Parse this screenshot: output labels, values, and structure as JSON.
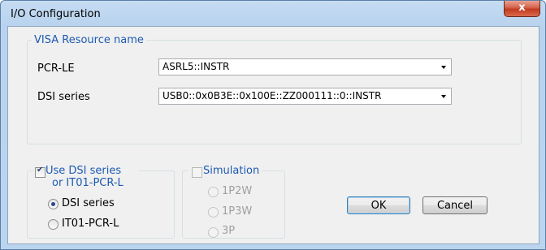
{
  "window": {
    "title": "I/O Configuration",
    "close_glyph": "x"
  },
  "visa_group": {
    "legend": "VISA Resource name",
    "pcr_label": "PCR-LE",
    "pcr_value": "ASRL5::INSTR",
    "dsi_label": "DSI series",
    "dsi_value": "USB0::0x0B3E::0x100E::ZZ000111::0::INSTR"
  },
  "use_group": {
    "checkbox_label_line1": "Use DSI series",
    "checkbox_label_line2": "or IT01-PCR-L",
    "checked": true,
    "options": [
      "DSI series",
      "IT01-PCR-L"
    ],
    "selected": "DSI series"
  },
  "sim_group": {
    "checkbox_label": "Simulation",
    "checked": false,
    "options": [
      "1P2W",
      "1P3W",
      "3P"
    ]
  },
  "buttons": {
    "ok": "OK",
    "cancel": "Cancel"
  }
}
